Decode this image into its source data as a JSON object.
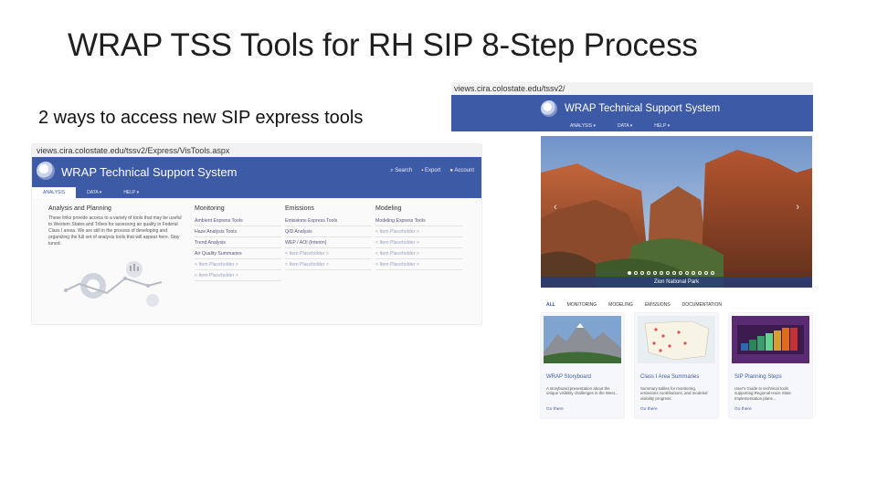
{
  "slide": {
    "title": "WRAP TSS Tools for RH SIP 8-Step Process",
    "subtitle": "2 ways to access new SIP express tools"
  },
  "left_screenshot": {
    "url": "views.cira.colostate.edu/tssv2/Express/VisTools.aspx",
    "site_name": "WRAP Technical Support System",
    "header_links": [
      "Search",
      "Export",
      "Account"
    ],
    "nav": [
      "ANALYSIS",
      "DATA ▾",
      "HELP ▾"
    ],
    "intro": {
      "heading": "Analysis and Planning",
      "text": "These links provide access to a variety of tools that may be useful to Western States and Tribes for assessing air quality in Federal Class I areas. We are still in the process of developing and organizing the full set of analysis tools that will appear here. Stay tuned."
    },
    "columns": [
      {
        "heading": "Monitoring",
        "links": [
          "Ambient Express Tools",
          "Haze Analysis Tools",
          "Trend Analysis",
          "Air Quality Summaries",
          "< Item Placeholder >",
          "< Item Placeholder >"
        ]
      },
      {
        "heading": "Emissions",
        "links": [
          "Emissions Express Tools",
          "Q/D Analysis",
          "WEP / AOI (Interim)",
          "< Item Placeholder >",
          "< Item Placeholder >"
        ]
      },
      {
        "heading": "Modeling",
        "links": [
          "Modeling Express Tools",
          "< Item Placeholder >",
          "< Item Placeholder >",
          "< Item Placeholder >",
          "< Item Placeholder >"
        ]
      }
    ]
  },
  "right_screenshot": {
    "url": "views.cira.colostate.edu/tssv2/",
    "site_name": "WRAP Technical Support System",
    "nav": [
      "ANALYSIS ▾",
      "DATA ▾",
      "HELP ▾"
    ],
    "hero_caption": "Zion National Park",
    "carousel_dot_count": 14,
    "carousel_active_index": 0,
    "tabs": [
      "ALL",
      "MONITORING",
      "MODELING",
      "EMISSIONS",
      "DOCUMENTATION"
    ],
    "active_tab": "ALL",
    "cards": [
      {
        "title": "WRAP Storyboard",
        "description": "A storyboard presentation about the unique visibility challenges in the West...",
        "more": "Go there"
      },
      {
        "title": "Class I Area Summaries",
        "description": "Summary tables for monitoring, emissions contributions, and modeled visibility progress.",
        "more": "Go there"
      },
      {
        "title": "SIP Planning Steps",
        "description": "User's Guide to technical tools supporting Regional Haze State Implementation plans...",
        "more": "Go there"
      }
    ]
  },
  "colors": {
    "brand_blue": "#3d5aa6",
    "url_bar_bg": "#f2f2f2",
    "link_text": "#557799"
  }
}
